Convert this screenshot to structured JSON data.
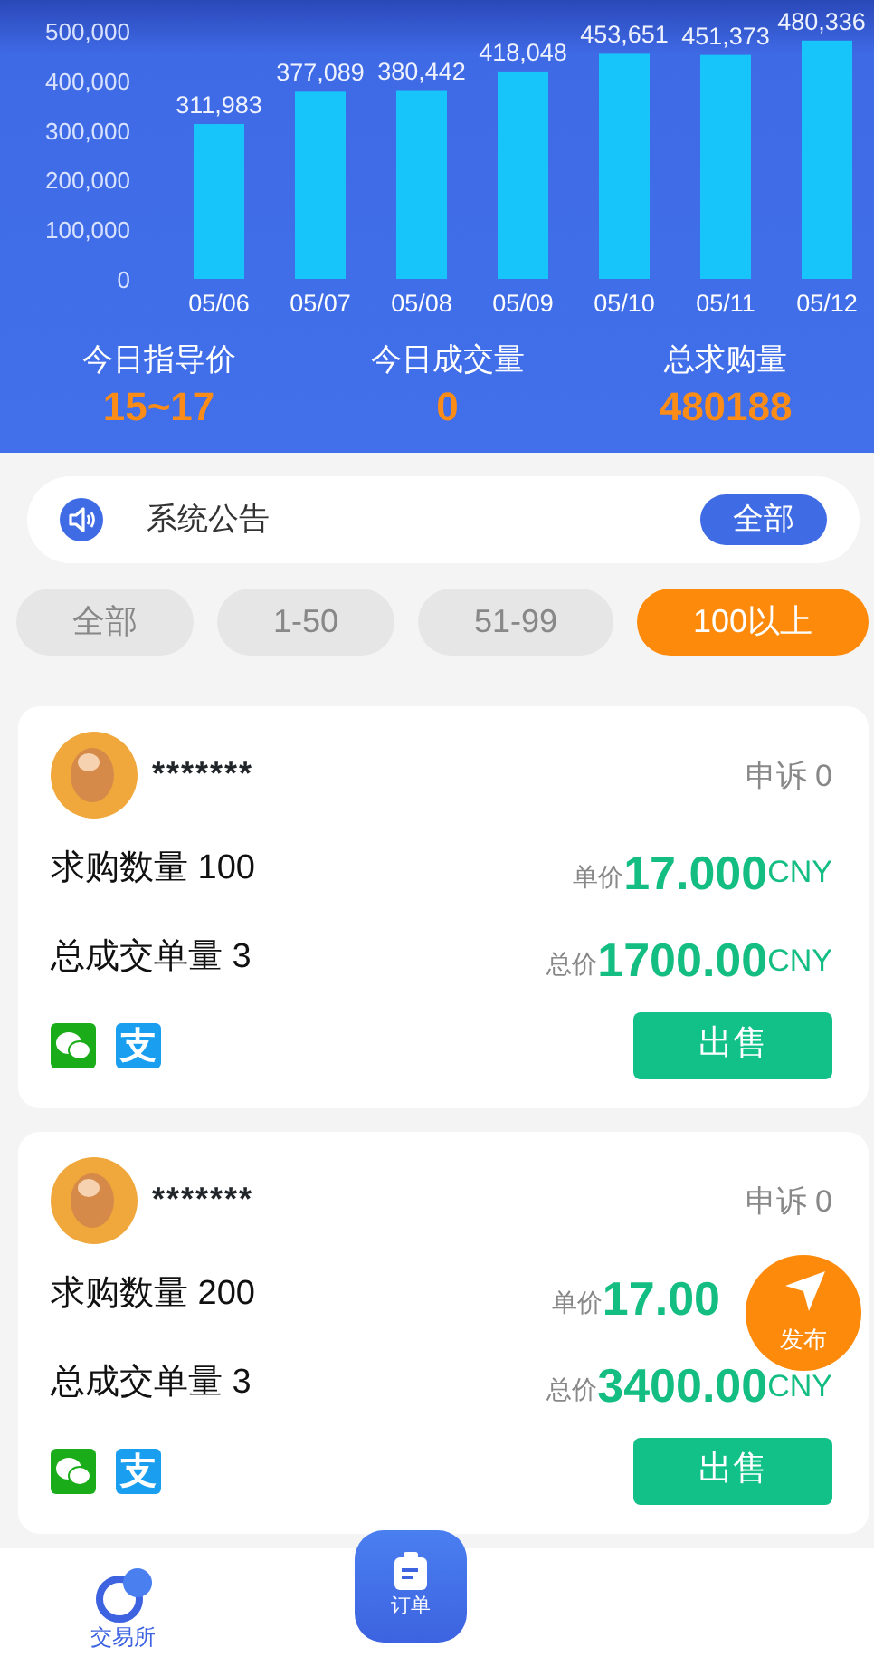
{
  "header": {
    "chart_data": {
      "type": "bar",
      "categories": [
        "05/06",
        "05/07",
        "05/08",
        "05/09",
        "05/10",
        "05/11",
        "05/12"
      ],
      "series": [
        {
          "color": "#18c5fb",
          "values": [
            311983,
            377089,
            380442,
            418048,
            453651,
            451373,
            480336
          ]
        }
      ],
      "ylim": [
        0,
        500000
      ],
      "yticks": [
        {
          "value": 0,
          "label": "0"
        },
        {
          "value": 100000,
          "label": "100,000"
        },
        {
          "value": 200000,
          "label": "200,000"
        },
        {
          "value": 300000,
          "label": "300,000"
        },
        {
          "value": 400000,
          "label": "400,000"
        },
        {
          "value": 500000,
          "label": "500,000"
        }
      ],
      "value_labels": [
        "311,983",
        "377,089",
        "380,442",
        "418,048",
        "453,651",
        "451,373",
        "480,336"
      ]
    },
    "stats": [
      {
        "label": "今日指导价",
        "value": "15~17"
      },
      {
        "label": "今日成交量",
        "value": "0"
      },
      {
        "label": "总求购量",
        "value": "480188"
      }
    ]
  },
  "notice": {
    "title": "系统公告",
    "button": "全部"
  },
  "filters": [
    {
      "label": "全部",
      "selected": false
    },
    {
      "label": "1-50",
      "selected": false
    },
    {
      "label": "51-99",
      "selected": false
    },
    {
      "label": "100以上",
      "selected": true
    }
  ],
  "orders": [
    {
      "name": "*******",
      "appeal": "申诉 0",
      "quantity": "求购数量 100",
      "unit_label": "单价",
      "unit_price": "17.000",
      "unit_currency": "CNY",
      "deals": "总成交单量 3",
      "total_label": "总价",
      "total_price": "1700.00",
      "total_currency": "CNY",
      "payments": [
        {
          "kind": "wechat"
        },
        {
          "kind": "alipay",
          "glyph": "支"
        }
      ],
      "button": "出售"
    },
    {
      "name": "*******",
      "appeal": "申诉 0",
      "quantity": "求购数量 200",
      "unit_label": "单价",
      "unit_price": "17.00",
      "deals": "总成交单量 3",
      "total_label": "总价",
      "total_price": "3400.00",
      "total_currency": "CNY",
      "payments": [
        {
          "kind": "wechat"
        },
        {
          "kind": "alipay",
          "glyph": "支"
        }
      ],
      "button": "出售"
    }
  ],
  "fab": {
    "label": "发布"
  },
  "bottom_nav": [
    {
      "kind": "exchange",
      "label": "交易所"
    },
    {
      "kind": "orders",
      "label": "订单"
    }
  ]
}
